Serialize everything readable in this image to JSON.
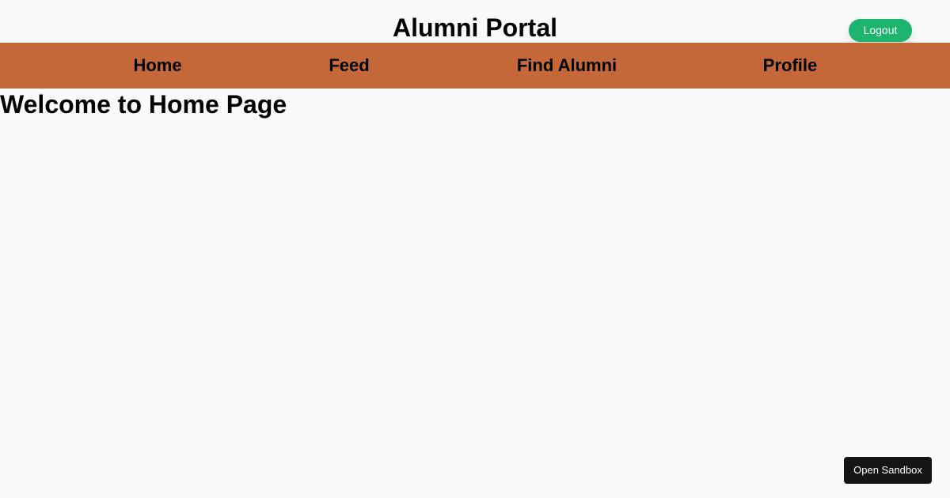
{
  "header": {
    "title": "Alumni Portal",
    "logout_label": "Logout"
  },
  "nav": {
    "items": [
      {
        "label": "Home"
      },
      {
        "label": "Feed"
      },
      {
        "label": "Find Alumni"
      },
      {
        "label": "Profile"
      }
    ]
  },
  "main": {
    "heading": "Welcome to Home Page"
  },
  "sandbox": {
    "label": "Open Sandbox"
  },
  "colors": {
    "background": "#fafafa",
    "navbar": "#c4683a",
    "logout_button": "#1db46f",
    "sandbox_button": "#151515"
  }
}
